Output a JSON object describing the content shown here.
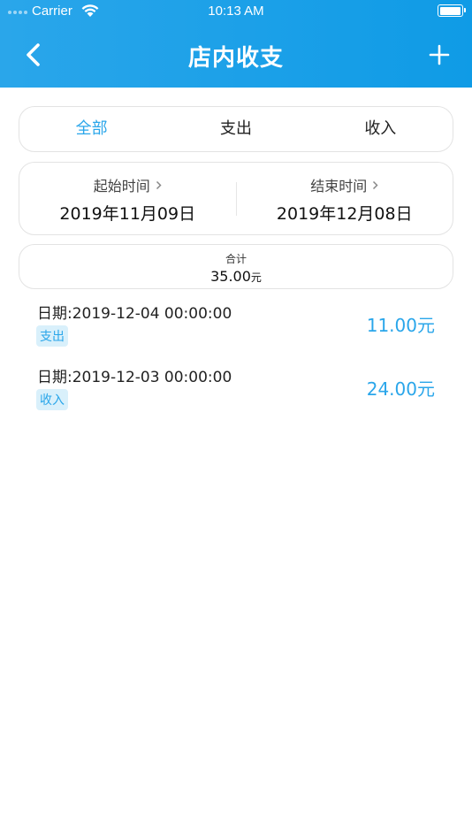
{
  "status_bar": {
    "carrier": "Carrier",
    "time": "10:13 AM"
  },
  "header": {
    "title": "店内收支",
    "back_icon": "chevron-left-icon",
    "add_icon": "plus-icon",
    "background_color": "#1ea0e8"
  },
  "tabs": [
    {
      "label": "全部",
      "active": true
    },
    {
      "label": "支出",
      "active": false
    },
    {
      "label": "收入",
      "active": false
    }
  ],
  "date_range": {
    "start_label": "起始时间",
    "start_value": "2019年11月09日",
    "end_label": "结束时间",
    "end_value": "2019年12月08日"
  },
  "total": {
    "label": "合计",
    "value": "35.00",
    "unit": "元"
  },
  "records": [
    {
      "date": "日期:2019-12-04 00:00:00",
      "type": "支出",
      "amount": "11.00元"
    },
    {
      "date": "日期:2019-12-03 00:00:00",
      "type": "收入",
      "amount": "24.00元"
    }
  ],
  "colors": {
    "accent": "#2aa6ea",
    "tag_background": "#d9f0fb"
  }
}
